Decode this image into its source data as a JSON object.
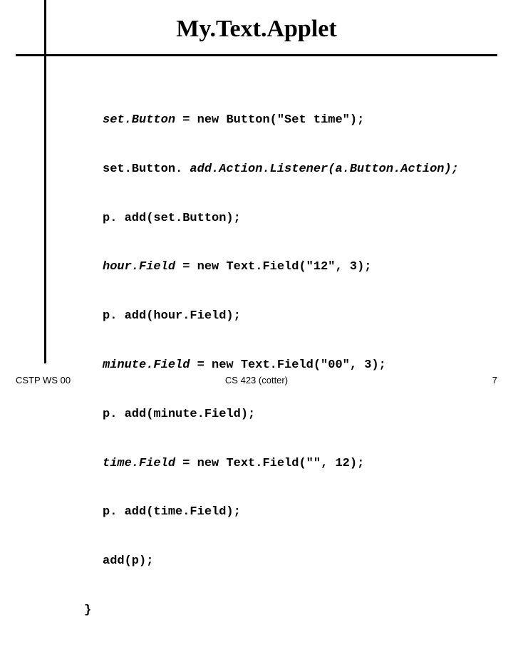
{
  "title": "My.Text.Applet",
  "code": {
    "l1a": "set.Button",
    "l1b": " = new Button(\"Set time\");",
    "l2a": "set.Button. ",
    "l2b": "add.Action.Listener(a.Button.Action);",
    "l3": "p. add(set.Button);",
    "l4a": "hour.Field",
    "l4b": " = new Text.Field(\"12\", 3);",
    "l5": "p. add(hour.Field);",
    "l6a": "minute.Field",
    "l6b": " = new Text.Field(\"00\", 3);",
    "l7": "p. add(minute.Field);",
    "l8a": "time.Field",
    "l8b": " = new Text.Field(\"\", 12);",
    "l9": "p. add(time.Field);",
    "l10": "add(p);",
    "close": "}"
  },
  "footer": {
    "left": "CSTP WS 00",
    "center": "CS 423 (cotter)",
    "right": "7"
  }
}
